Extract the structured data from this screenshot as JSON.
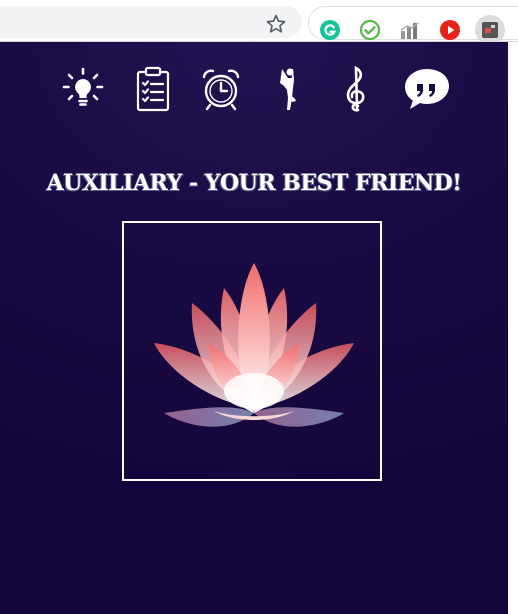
{
  "browser": {
    "toolbar_icons": [
      "star-icon"
    ],
    "extensions": [
      {
        "name": "grammarly-extension-icon",
        "color": "#15c39a"
      },
      {
        "name": "checkmark-extension-icon",
        "color": "#55b848"
      },
      {
        "name": "analytics-extension-icon",
        "color": "#888888"
      },
      {
        "name": "youtube-play-extension-icon",
        "color": "#e62117"
      },
      {
        "name": "app-extension-icon",
        "color": "#555555"
      }
    ]
  },
  "app": {
    "colors": {
      "background": "#1a0b44",
      "foreground": "#ffffff",
      "accent": "#f26b6b"
    },
    "nav_icons": [
      "lightbulb-icon",
      "clipboard-checklist-icon",
      "alarm-clock-icon",
      "yoga-pose-icon",
      "treble-clef-icon",
      "quote-bubble-icon"
    ],
    "headline": "AUXILIARY - YOUR BEST FRIEND!",
    "hero_image": "lotus-flower-icon"
  }
}
